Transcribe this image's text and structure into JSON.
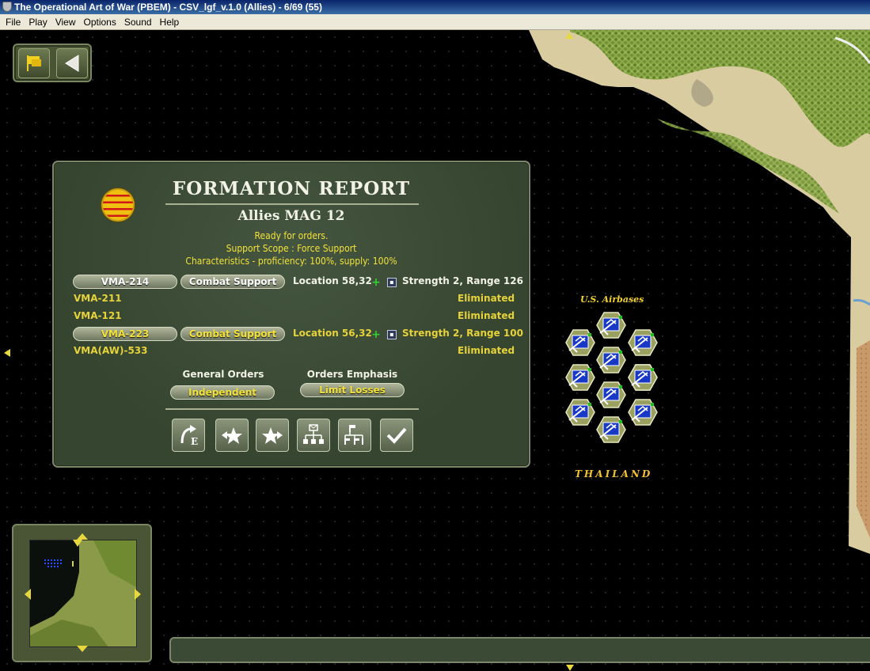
{
  "window": {
    "title": "The Operational Art of War (PBEM) - CSV_lgf_v.1.0 (Allies) - 6/69 (55)"
  },
  "menu": [
    "File",
    "Play",
    "View",
    "Options",
    "Sound",
    "Help"
  ],
  "panel": {
    "title": "FORMATION REPORT",
    "formation_name": "Allies MAG 12",
    "status": "Ready for orders.",
    "support_scope": "Support Scope :  Force Support",
    "characteristics": "Characteristics - proficiency: 100%, supply: 100%",
    "units": [
      {
        "name": "VMA-214",
        "role": "Combat Support",
        "location": "Location 58,32",
        "detail": "Strength 2, Range 126",
        "active": true
      },
      {
        "name": "VMA-211",
        "detail": "Eliminated",
        "active": false
      },
      {
        "name": "VMA-121",
        "detail": "Eliminated",
        "active": false
      },
      {
        "name": "VMA-223",
        "role": "Combat Support",
        "location": "Location 56,32",
        "detail": "Strength 2, Range 100",
        "active": true
      },
      {
        "name": "VMA(AW)-533",
        "detail": "Eliminated",
        "active": false
      }
    ],
    "general_orders_label": "General Orders",
    "general_orders_value": "Independent",
    "orders_emphasis_label": "Orders Emphasis",
    "orders_emphasis_value": "Limit Losses"
  },
  "map": {
    "airbase_label": "U.S. Airbases",
    "country_label": "THAILAND"
  },
  "colors": {
    "panel_bg": "#3a4a34",
    "text_yellow": "#f2e23a",
    "terrain_light": "#d8ceA0",
    "terrain_green": "#7a9a3a"
  }
}
